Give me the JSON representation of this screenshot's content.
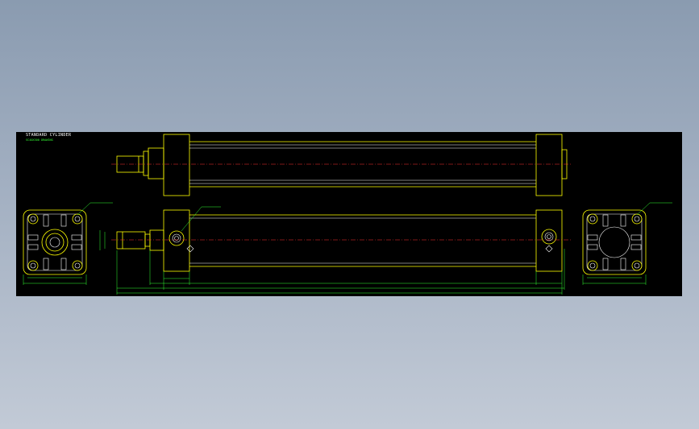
{
  "drawing": {
    "title": "STANDARD CYLINDER",
    "subtitle": "SC40X300 DRAWING"
  },
  "colors": {
    "background": "#000000",
    "outline": "#ffff00",
    "detail": "#ffffff",
    "dimension": "#33ff33",
    "centerline": "#ff3333"
  }
}
